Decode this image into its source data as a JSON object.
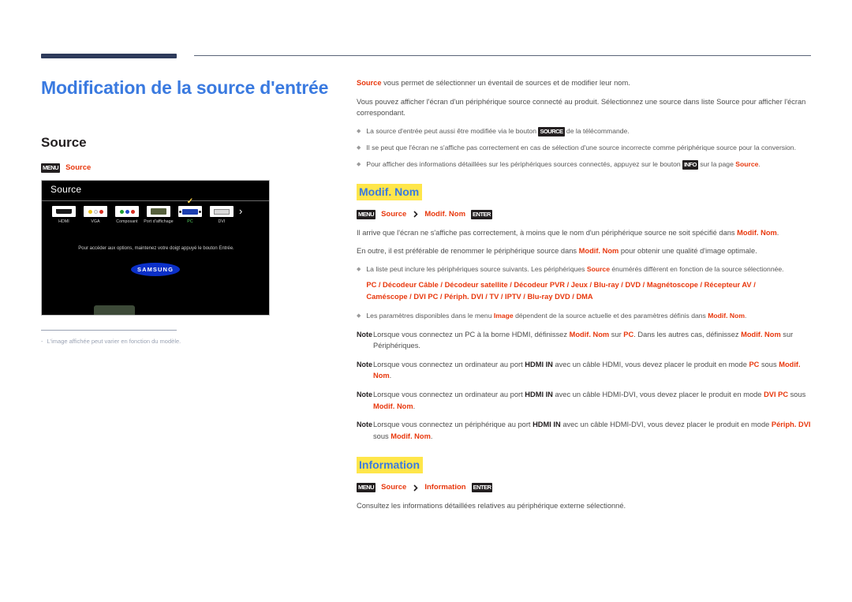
{
  "document": {
    "title": "Modification de la source d'entrée",
    "left_section_title": "Source"
  },
  "left": {
    "nav_path": {
      "menu_key": "MENU",
      "item": "Source",
      "arrow": "chevron-right"
    },
    "tv": {
      "panel_title": "Source",
      "sources": [
        {
          "label": "HDMI",
          "icon": "hdmi-port-icon",
          "active": false
        },
        {
          "label": "VGA",
          "icon": "rca-av-icon",
          "active": false
        },
        {
          "label": "Composant",
          "icon": "component-rca-icon",
          "active": false
        },
        {
          "label": "Port d'affichage",
          "icon": "displayport-icon",
          "active": false
        },
        {
          "label": "PC",
          "icon": "vga-dsub-icon",
          "active": true
        },
        {
          "label": "DVI",
          "icon": "dvi-port-icon",
          "active": false
        }
      ],
      "next_arrow": "chevron-right-icon",
      "hint": "Pour accéder aux options, maintenez votre doigt appuyé le bouton Entrée.",
      "brand": "SAMSUNG"
    },
    "footnote": {
      "dash": "-",
      "text": "L'image affichée peut varier en fonction du modèle."
    }
  },
  "right": {
    "intro": {
      "term": "Source",
      "rest": "vous permet de sélectionner un éventail de sources et de modifier leur nom."
    },
    "lead_paragraph": "Vous pouvez afficher l'écran d'un périphérique source connecté au produit. Sélectionnez une source dans liste Source pour afficher l'écran correspondant.",
    "intro_bullets": [
      {
        "pre": "La source d'entrée peut aussi être modifiée via le bouton ",
        "key": "SOURCE",
        "post": " de la télécommande."
      },
      {
        "pre": "Il se peut que l'écran ne s'affiche pas correctement en cas de sélection d'une source incorrecte comme périphérique source pour la conversion.",
        "key": "",
        "post": ""
      },
      {
        "pre": "Pour afficher des informations détaillées sur les périphériques sources connectés, appuyez sur le bouton ",
        "key": "INFO",
        "post": " sur la page ",
        "term": "Source",
        "end": "."
      }
    ],
    "modif_nom": {
      "heading": "Modif. Nom",
      "nav_path": {
        "menu_key": "MENU",
        "item1": "Source",
        "item2": "Modif. Nom",
        "enter_key": "ENTER"
      },
      "p1_a": "Il arrive que l'écran ne s'affiche pas correctement, à moins que le nom d'un périphérique source ne soit spécifié dans ",
      "p1_b": "Modif. Nom",
      "p1_c": ".",
      "p2_a": "En outre, il est préférable de renommer le périphérique source dans ",
      "p2_b": "Modif. Nom",
      "p2_c": " pour obtenir une qualité d'image optimale.",
      "bullet_devices": {
        "pre": "La liste peut inclure les périphériques source suivants. Les périphériques ",
        "term": "Source",
        "post": " énumérés diffèrent en fonction de la source sélectionnée.",
        "line1": "PC / Décodeur Câble / Décodeur satellite / Décodeur PVR / Jeux / Blu-ray / DVD / Magnétoscope / Récepteur AV /",
        "line2": "Caméscope / DVI PC / Périph. DVI / TV / IPTV / Blu-ray DVD / DMA"
      },
      "bullet_image": {
        "pre": "Les paramètres disponibles dans le menu ",
        "mid": "Image",
        "post": " dépendent de la source actuelle et des paramètres définis dans ",
        "term": "Modif. Nom",
        "end": "."
      },
      "notes": [
        {
          "marker": "Note",
          "a": "Lorsque vous connectez un PC à la borne HDMI, définissez ",
          "b": "Modif. Nom",
          "c": " sur ",
          "d": "PC",
          "e": ". Dans les autres cas, définissez ",
          "f": "Modif. Nom",
          "g": " sur Périphériques."
        },
        {
          "marker": "Note",
          "a": "Lorsque vous connectez un ordinateur au port ",
          "b": "HDMI IN",
          "c": " avec un câble HDMI, vous devez placer le produit en mode ",
          "d": "PC",
          "e": " sous ",
          "f": "Modif. Nom",
          "g": "."
        },
        {
          "marker": "Note",
          "a": "Lorsque vous connectez un ordinateur au port ",
          "b": "HDMI IN",
          "c": " avec un câble HDMI-DVI, vous devez placer le produit en mode ",
          "d": "DVI PC",
          "e": " sous ",
          "f": "Modif. Nom",
          "g": "."
        },
        {
          "marker": "Note",
          "a": "Lorsque vous connectez un périphérique au port ",
          "b": "HDMI IN",
          "c": " avec un câble HDMI-DVI, vous devez placer le produit en mode ",
          "d": "Périph. DVI",
          "e": " sous ",
          "f": "Modif. Nom",
          "g": "."
        }
      ]
    },
    "information": {
      "heading": "Information",
      "nav_path": {
        "menu_key": "MENU",
        "item1": "Source",
        "item2": "Information",
        "enter_key": "ENTER"
      },
      "paragraph": "Consultez les informations détaillées relatives au périphérique externe sélectionné."
    }
  },
  "colors": {
    "title_blue": "#3a7ae0",
    "accent_red": "#e8380d",
    "highlight_yellow": "#ffe64a",
    "rule_navy": "#2e3b5b",
    "samsung_blue": "#0b30c8",
    "active_green": "#55d25f",
    "tick_yellow": "#ffd84d"
  }
}
